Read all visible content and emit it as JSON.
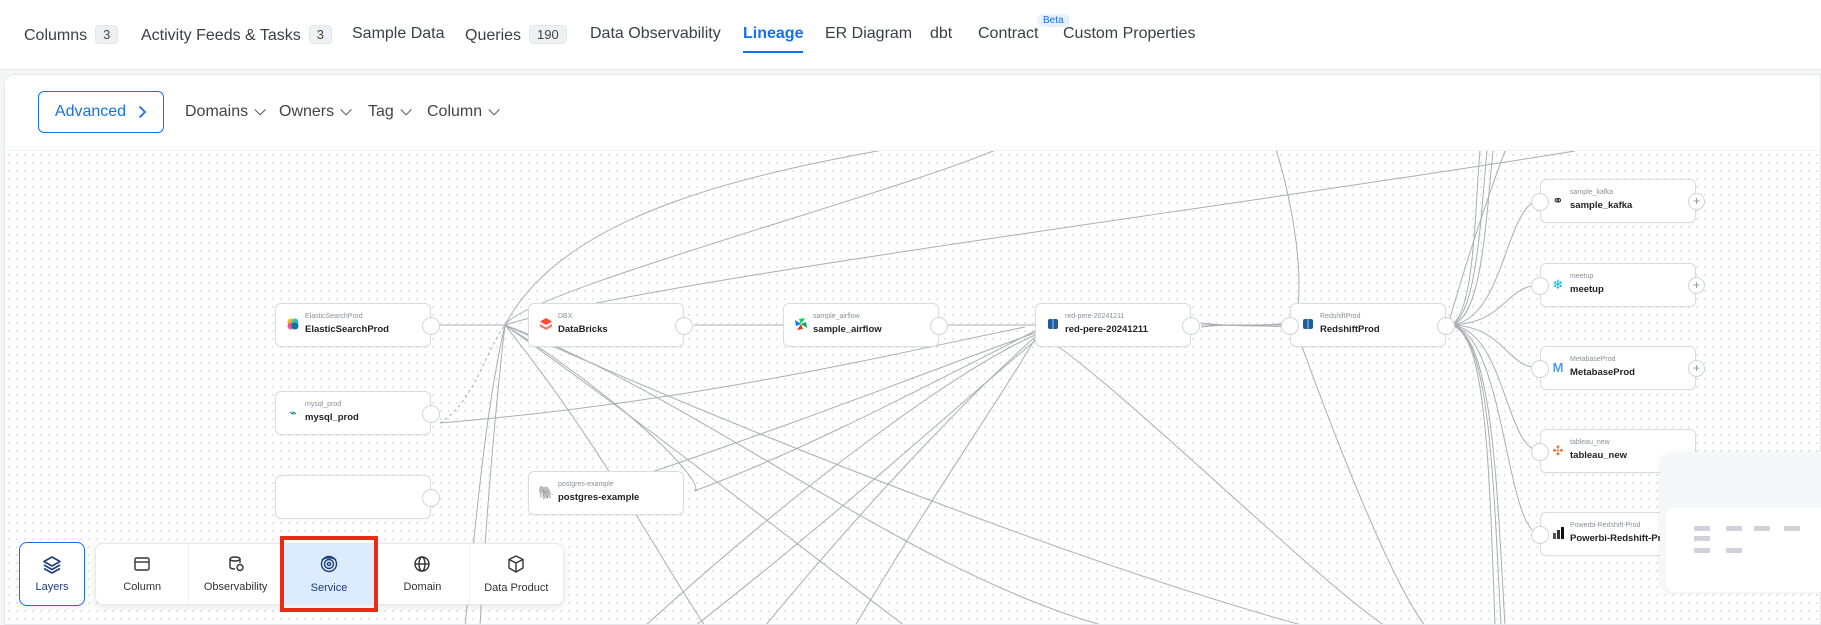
{
  "tabs": [
    {
      "label": "Columns",
      "count": "3"
    },
    {
      "label": "Activity Feeds & Tasks",
      "count": "3"
    },
    {
      "label": "Sample Data"
    },
    {
      "label": "Queries",
      "count": "190"
    },
    {
      "label": "Data Observability"
    },
    {
      "label": "Lineage",
      "active": true
    },
    {
      "label": "ER Diagram"
    },
    {
      "label": "dbt"
    },
    {
      "label": "Contract",
      "badge": "Beta"
    },
    {
      "label": "Custom Properties"
    }
  ],
  "filters": {
    "advanced_label": "Advanced",
    "dropdowns": [
      "Domains",
      "Owners",
      "Tag",
      "Column"
    ]
  },
  "nodes": {
    "elasticsearch": {
      "service": "ElasticSearchProd",
      "name": "ElasticSearchProd",
      "icon": "elasticsearch-icon"
    },
    "mysql": {
      "service": "mysql_prod",
      "name": "mysql_prod",
      "icon": "mysql-icon"
    },
    "databricks": {
      "service": "DBX",
      "name": "DataBricks",
      "icon": "databricks-icon"
    },
    "postgres": {
      "service": "postgres-example",
      "name": "postgres-example",
      "icon": "postgres-icon"
    },
    "airflow": {
      "service": "sample_airflow",
      "name": "sample_airflow",
      "icon": "airflow-icon"
    },
    "redpere": {
      "service": "red-pere-20241211",
      "name": "red-pere-20241211",
      "icon": "redshift-icon"
    },
    "redshift": {
      "service": "RedshiftProd",
      "name": "RedshiftProd",
      "icon": "redshift-icon"
    },
    "kafka": {
      "service": "sample_kafka",
      "name": "sample_kafka",
      "icon": "kafka-icon"
    },
    "meetup": {
      "service": "meetup",
      "name": "meetup",
      "icon": "meetup-icon"
    },
    "metabase": {
      "service": "MetabaseProd",
      "name": "MetabaseProd",
      "icon": "metabase-icon"
    },
    "tableau": {
      "service": "tableau_new",
      "name": "tableau_new",
      "icon": "tableau-icon"
    },
    "powerbi": {
      "service": "Powerbi-Redshift-Prod",
      "name": "Powerbi-Redshift-Prod",
      "icon": "powerbi-icon"
    }
  },
  "layers": {
    "button_label": "Layers",
    "items": [
      {
        "label": "Column",
        "icon": "column-icon"
      },
      {
        "label": "Observability",
        "icon": "observability-icon"
      },
      {
        "label": "Service",
        "icon": "service-icon",
        "selected": true
      },
      {
        "label": "Domain",
        "icon": "domain-icon"
      },
      {
        "label": "Data Product",
        "icon": "data-product-icon"
      }
    ]
  },
  "colors": {
    "accent": "#1570ef",
    "highlight_box": "#ec2b14",
    "selected_layer_bg": "#ddebff",
    "edge": "#a9adb3"
  }
}
